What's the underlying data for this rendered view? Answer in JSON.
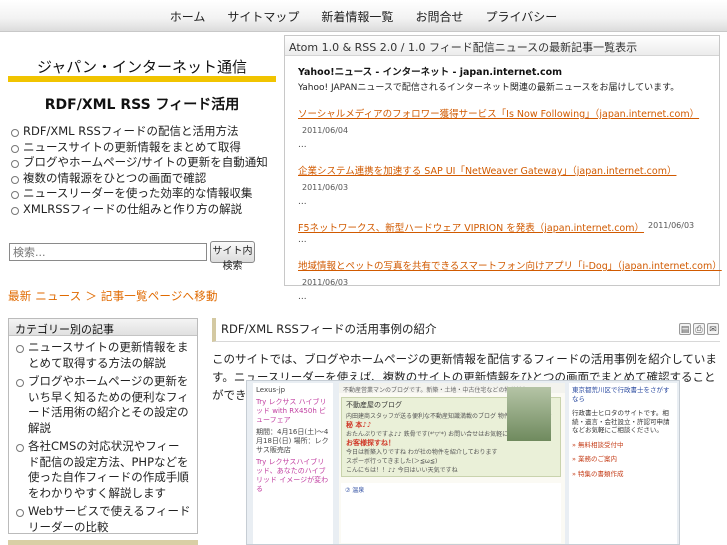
{
  "nav": {
    "items": [
      "ホーム",
      "サイトマップ",
      "新着情報一覧",
      "お問合せ",
      "プライバシー"
    ]
  },
  "site": {
    "title": "ジャパン・インターネット通信",
    "subtitle": "RDF/XML RSS フィード活用"
  },
  "features": [
    "RDF/XML RSSフィードの配信と活用方法",
    "ニュースサイトの更新情報をまとめて取得",
    "ブログやホームページ/サイトの更新を自動通知",
    "複数の情報源をひとつの画面で確認",
    "ニュースリーダーを使った効率的な情報収集",
    "XMLRSSフィードの仕組みと作り方の解説"
  ],
  "search": {
    "placeholder": "検索...",
    "button": "サイト内検索"
  },
  "orange_link": "最新 ニュース ＞ 記事一覧ページへ移動",
  "sidebar_box": {
    "title": "カテゴリー別の記事",
    "items": [
      "ニュースサイトの更新情報をまとめて取得する方法の解説",
      "ブログやホームページの更新をいち早く知るための便利なフィード活用術の紹介とその設定の解説",
      "各社CMSの対応状況やフィード配信の設定方法、PHPなどを使った自作フィードの作成手順をわかりやすく解説します",
      "Webサービスで使えるフィードリーダーの比較"
    ]
  },
  "feed": {
    "title": "Atom 1.0 & RSS 2.0 / 1.0 フィード配信ニュースの最新記事一覧表示",
    "source_title": "Yahoo!ニュース - インターネット - japan.internet.com",
    "source_desc": "Yahoo! JAPANニュースで配信されるインターネット関連の最新ニュースをお届けしています。",
    "items": [
      {
        "title": "ソーシャルメディアのフォロワー獲得サービス「Is Now Following」（japan.internet.com）",
        "date": "2011/06/04",
        "excerpt": "..."
      },
      {
        "title": "企業システム連携を加速する SAP UI「NetWeaver Gateway」（japan.internet.com）",
        "date": "2011/06/03",
        "excerpt": "..."
      },
      {
        "title": "F5ネットワークス、新型ハードウェア VIPRION を発表（japan.internet.com）",
        "date": "2011/06/03",
        "excerpt": "..."
      },
      {
        "title": "地域情報とペットの写真を共有できるスマートフォン向けアプリ「i-Dog」（japan.internet.com）",
        "date": "2011/06/03",
        "excerpt": "..."
      }
    ]
  },
  "post": {
    "heading": "RDF/XML RSSフィードの活用事例の紹介",
    "icons": [
      "pdf-icon",
      "print-icon",
      "email-icon"
    ],
    "body": "このサイトでは、ブログやホームページの更新情報を配信するフィードの活用事例を紹介しています。ニュースリーダーを使えば、複数のサイトの更新情報をひとつの画面でまとめて確認することができ、効率的な情報収集に役立ちます。"
  },
  "screenshot": {
    "col1_title": "Lexus-jp",
    "col1_link": "Try レクサス ハイブリッド with RX450h ビューフェア",
    "col1_text": "期間：4月16日(土)〜4月18日(日) 場所：レクサス販売店",
    "col1_link2": "Try レクサスハイブリッド、あなたのハイブリッド イメージが変わる",
    "col2_bar": "不動産営業マンのブログです。新築・土地・中古住宅などの物件情報",
    "col2_card_title": "不動産屋のブログ",
    "col2_card_lines": [
      "内田建商スタッフが送る便利な不動産知識満載のブログ 物件選びのノウハウ",
      "秘 本♪♪",
      "おたんぷりですよ♪♪ 鉄骨です(*'▽'*) お問い合せはお気軽にどうぞ",
      "お客様探すね！",
      "今日は新築入りですね わが社の物件を紹介しております",
      "スポーボ行ってきました(＞≦ω≦)",
      "こんにちは！！♪♪ 今日はいい天気ですね"
    ],
    "col2_lower": "⑦ 温泉",
    "col3_title": "東京都荒川区で行政書士をさがすなら",
    "col3_text": "行政書士ヒロタのサイトです。相続・遺言・会社設立・許認可申請などお気軽にご相談ください。",
    "col3_links": [
      "» 無料相談受付中",
      "» 業務のご案内",
      "» 特集の書類作成"
    ]
  }
}
